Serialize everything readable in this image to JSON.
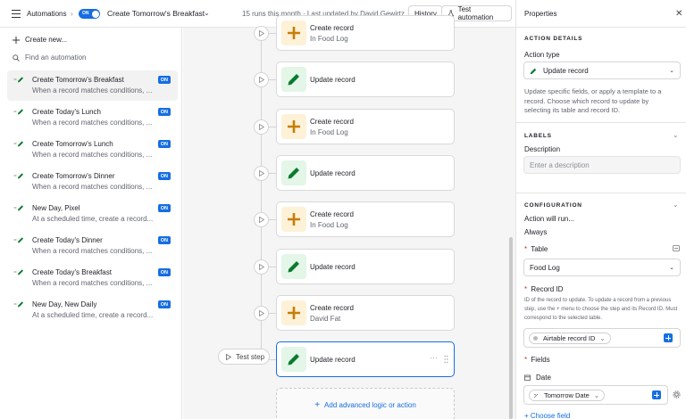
{
  "topbar": {
    "section": "Automations",
    "toggle_label": "ON",
    "automation_name": "Create Tomorrow's Breakfast",
    "status": "15 runs this month · Last updated by David Gewirtz",
    "history_label": "History",
    "test_label": "Test automation"
  },
  "sidebar": {
    "create_new": "Create new...",
    "find_placeholder": "Find an automation",
    "items": [
      {
        "title": "Create Tomorrow's Breakfast",
        "subtitle": "When a record matches conditions, ...",
        "badge": "ON"
      },
      {
        "title": "Create Today's Lunch",
        "subtitle": "When a record matches conditions, ...",
        "badge": "ON"
      },
      {
        "title": "Create Tomorrow's Lunch",
        "subtitle": "When a record matches conditions, ...",
        "badge": "ON"
      },
      {
        "title": "Create Tomorrow's Dinner",
        "subtitle": "When a record matches conditions, ...",
        "badge": "ON"
      },
      {
        "title": "New Day, Pixel",
        "subtitle": "At a scheduled time, create a record...",
        "badge": "ON"
      },
      {
        "title": "Create Today's Dinner",
        "subtitle": "When a record matches conditions, ...",
        "badge": "ON"
      },
      {
        "title": "Create Today's Breakfast",
        "subtitle": "When a record matches conditions, ...",
        "badge": "ON"
      },
      {
        "title": "New Day, New Daily",
        "subtitle": "At a scheduled time, create a record...",
        "badge": "ON"
      }
    ]
  },
  "canvas": {
    "steps": [
      {
        "title": "Create record",
        "subtitle": "In Food Log",
        "icon": "plus-icon"
      },
      {
        "title": "Update record",
        "subtitle": "",
        "icon": "pencil-icon"
      },
      {
        "title": "Create record",
        "subtitle": "In Food Log",
        "icon": "plus-icon"
      },
      {
        "title": "Update record",
        "subtitle": "",
        "icon": "pencil-icon"
      },
      {
        "title": "Create record",
        "subtitle": "In Food Log",
        "icon": "plus-icon"
      },
      {
        "title": "Update record",
        "subtitle": "",
        "icon": "pencil-icon"
      },
      {
        "title": "Create record",
        "subtitle": "David Fat",
        "icon": "plus-icon"
      },
      {
        "title": "Update record",
        "subtitle": "",
        "icon": "pencil-icon"
      }
    ],
    "test_step": "Test step",
    "add_logic": "Add advanced logic or action"
  },
  "properties": {
    "title": "Properties",
    "action_details": {
      "heading": "ACTION DETAILS",
      "action_type_label": "Action type",
      "action_type_value": "Update record",
      "description": "Update specific fields, or apply a template to a record. Choose which record to update by selecting its table and record ID."
    },
    "labels": {
      "heading": "LABELS",
      "description_label": "Description",
      "description_placeholder": "Enter a description"
    },
    "configuration": {
      "heading": "CONFIGURATION",
      "will_run_label": "Action will run...",
      "will_run_value": "Always",
      "table_label": "Table",
      "table_value": "Food Log",
      "record_id_label": "Record ID",
      "record_id_help": "ID of the record to update. To update a record from a previous step, use the + menu to choose the step and its Record ID. Must correspond to the selected table.",
      "record_id_token": "Airtable record ID",
      "fields_label": "Fields",
      "field_name": "Date",
      "field_token": "Tomorrow Date",
      "choose_field": "+ Choose field"
    }
  },
  "colors": {
    "accent": "#166ee1",
    "plus_icon": "#c77d0a",
    "pencil_icon": "#0a7a2e"
  }
}
